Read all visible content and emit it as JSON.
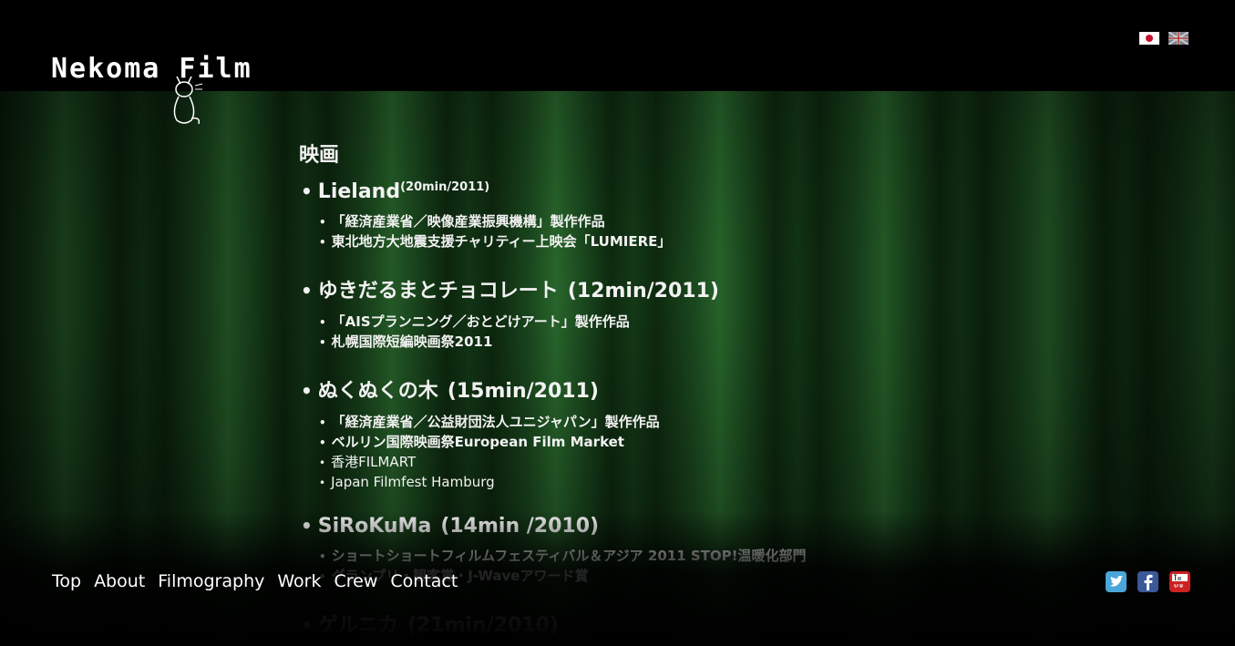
{
  "logo": {
    "text": "Nekoma Film"
  },
  "flags": [
    {
      "name": "japanese-flag"
    },
    {
      "name": "uk-flag"
    }
  ],
  "section_title": "映画",
  "films": [
    {
      "title": "Lieland",
      "duration": "(20min/2011)",
      "notes": [
        "「経済産業省／映像産業振興機構」製作作品",
        "東北地方大地震支援チャリティー上映会「LUMIERE」"
      ]
    },
    {
      "title": "ゆきだるまとチョコレート",
      "duration": "(12min/2011)",
      "notes": [
        "「AISプランニング／おとどけアート」製作作品",
        "札幌国際短編映画祭2011"
      ]
    },
    {
      "title": "ぬくぬくの木",
      "duration": "(15min/2011)",
      "notes": [
        "「経済産業省／公益財団法人ユニジャパン」製作作品",
        "ベルリン国際映画祭European Film Market",
        "香港FILMART",
        "Japan Filmfest Hamburg"
      ]
    },
    {
      "title": "SiRoKuMa",
      "duration": "(14min /2010)",
      "notes": [
        "ショートショートフィルムフェスティバル＆アジア 2011 STOP!温暖化部門",
        "グランプリ・観客賞・J-Waveアワード賞"
      ]
    },
    {
      "title": "ゲルニカ",
      "duration": "(21min/2010)",
      "notes": []
    }
  ],
  "nav": {
    "items": [
      "Top",
      "About",
      "Filmography",
      "Work",
      "Crew",
      "Contact"
    ]
  },
  "social": [
    {
      "icon": "twitter-icon",
      "color": "#4aa6d8"
    },
    {
      "icon": "facebook-icon",
      "color": "#3b5998"
    },
    {
      "icon": "youtube-icon",
      "color": "#cc2222"
    }
  ]
}
